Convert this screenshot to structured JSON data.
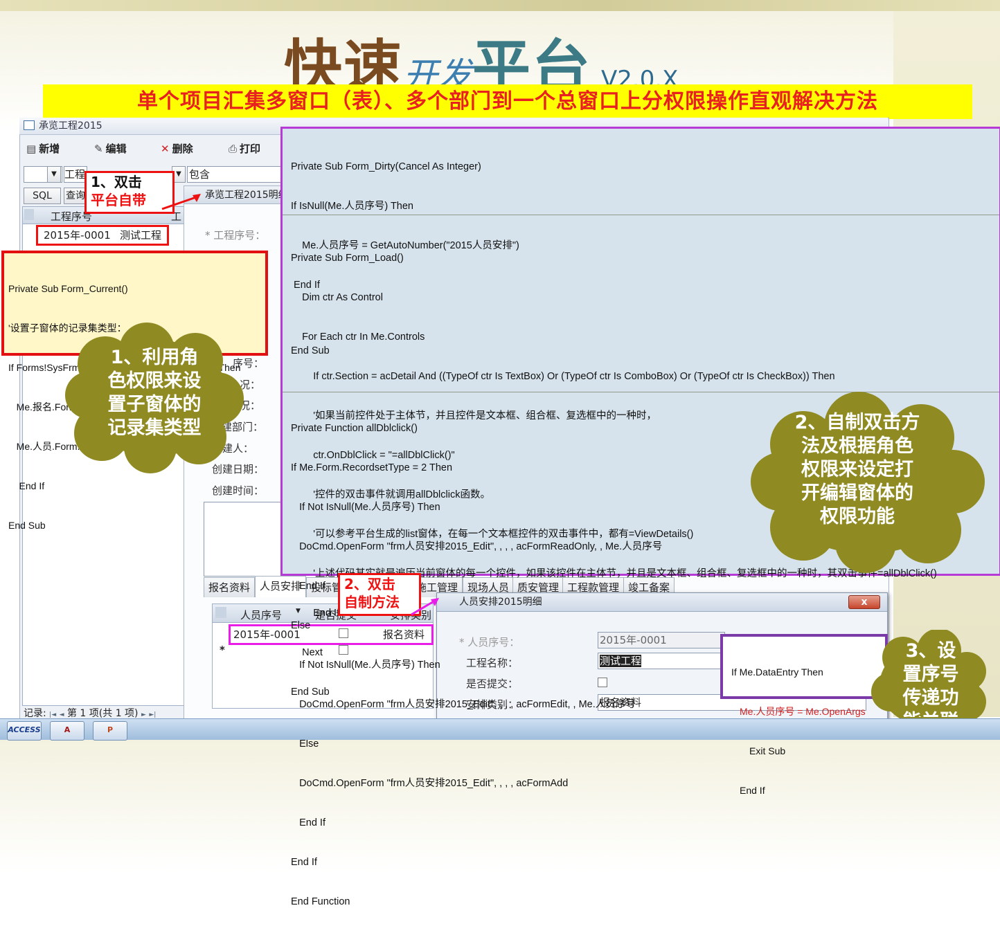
{
  "header": {
    "title_part1": "快速",
    "title_part2": "开发",
    "title_part3": "平台",
    "version": "V2.0.X",
    "banner": "单个项目汇集多窗口（表）、多个部门到一个总窗口上分权限操作直观解决方法"
  },
  "main_window": {
    "title": "承览工程2015",
    "toolbar": {
      "new": "新增",
      "edit": "编辑",
      "delete": "删除",
      "print": "打印"
    },
    "filter_field_label": "工程",
    "filter_mode": "包含",
    "sql_button": "SQL",
    "query_button": "查询",
    "grid_header": "工程序号",
    "grid_header2": "工",
    "grid_row": {
      "id": "2015年-0001",
      "name": "测试工程"
    },
    "record_nav": "记录: ",
    "record_text": "第 1 项(共 1 项)",
    "record_nav_first": "|◄",
    "record_nav_prev": "◄",
    "record_nav_next": "►",
    "record_nav_last": "►|"
  },
  "detail_form": {
    "title": "承览工程2015明细",
    "fields": [
      "* 工程序号：",
      "序号：",
      "况：",
      "况：",
      "建部门：",
      "创建人：",
      "创建日期：",
      "创建时间："
    ],
    "filter_value": "包含"
  },
  "tabs": [
    "报名资料",
    "人员安排",
    "投标管",
    "施工管理",
    "现场人员",
    "质安管理",
    "工程款管理",
    "竣工备案"
  ],
  "subgrid": {
    "columns": [
      "人员序号",
      "是否提交",
      "安排类别"
    ],
    "row": {
      "id": "2015年-0001",
      "category": "报名资料"
    },
    "new_row_marker": "*"
  },
  "popup": {
    "title": "人员安排2015明细",
    "close": "x",
    "labels": [
      "* 人员序号：",
      "工程名称：",
      "是否提交：",
      "安排类别："
    ],
    "values": {
      "id": "2015年-0001",
      "project": "测试工程",
      "category": "报名资料"
    }
  },
  "code_blocks": {
    "form_dirty": [
      "Private Sub Form_Dirty(Cancel As Integer)",
      "If IsNull(Me.人员序号) Then",
      "    Me.人员序号 = GetAutoNumber(\"2015人员安排\")",
      " End If",
      "",
      "End Sub"
    ],
    "form_load": [
      "Private Sub Form_Load()",
      "    Dim ctr As Control",
      "    For Each ctr In Me.Controls",
      "        If ctr.Section = acDetail And ((TypeOf ctr Is TextBox) Or (TypeOf ctr Is ComboBox) Or (TypeOf ctr Is CheckBox)) Then",
      "        '如果当前控件处于主体节，并且控件是文本框、组合框、复选框中的一种时，",
      "        ctr.OnDblClick = \"=allDblClick()\"",
      "        '控件的双击事件就调用allDblclick函数。",
      "        '可以参考平台生成的list窗体，在每一个文本框控件的双击事件中，都有=ViewDetails()",
      "        '上述代码其实就是遍历当前窗体的每一个控件，如果该控件在主体节，并且是文本框、组合框、复选框中的一种时，其双击事件=allDblClick()",
      "        End If",
      "    Next",
      "End Sub"
    ],
    "alldblclick": [
      "Private Function allDblclick()",
      "If Me.Form.RecordsetType = 2 Then",
      "   If Not IsNull(Me.人员序号) Then",
      "   DoCmd.OpenForm \"frm人员安排2015_Edit\", , , , acFormReadOnly, , Me.人员序号",
      "   End If",
      "Else",
      "   If Not IsNull(Me.人员序号) Then",
      "   DoCmd.OpenForm \"frm人员安排2015_Edit\", , , , acFormEdit, , Me.人员序号",
      "   Else",
      "   DoCmd.OpenForm \"frm人员安排2015_Edit\", , , , acFormAdd",
      "   End If",
      "End If",
      "End Function"
    ],
    "form_current": [
      "Private Sub Form_Current()",
      "'设置子窗体的记录集类型：",
      "If Forms!SysFrmMain!RoleName = \"系统管理员\" Then",
      "   Me.报名.Form.RecordsetType = 2",
      "   Me.人员.Form.RecordsetType = 1",
      "    End If",
      "End Sub"
    ],
    "data_entry": {
      "line1": "If Me.DataEntry Then",
      "line2": "Me.人员序号 = Me.OpenArgs",
      "line3": "Exit Sub",
      "line4": "End If"
    }
  },
  "callouts": {
    "step1_a": "1、双击",
    "step1_b": "平台自带",
    "step2_a": "2、双击",
    "step2_b": "自制方法",
    "cloud1": [
      "1、利用角",
      "色权限来设",
      "置子窗体的",
      "记录集类型"
    ],
    "cloud2": [
      "2、自制双击方",
      "法及根据角色",
      "权限来设定打",
      "开编辑窗体的",
      "权限功能"
    ],
    "cloud3": [
      "3、设",
      "置序号",
      "传递功",
      "能关联"
    ]
  },
  "taskbar": {
    "access_label": "ACCESS"
  },
  "colors": {
    "banner_bg": "#ffff00",
    "banner_text": "#e82020",
    "code_border": "#b63bd6",
    "cloud": "#8f8a22"
  }
}
